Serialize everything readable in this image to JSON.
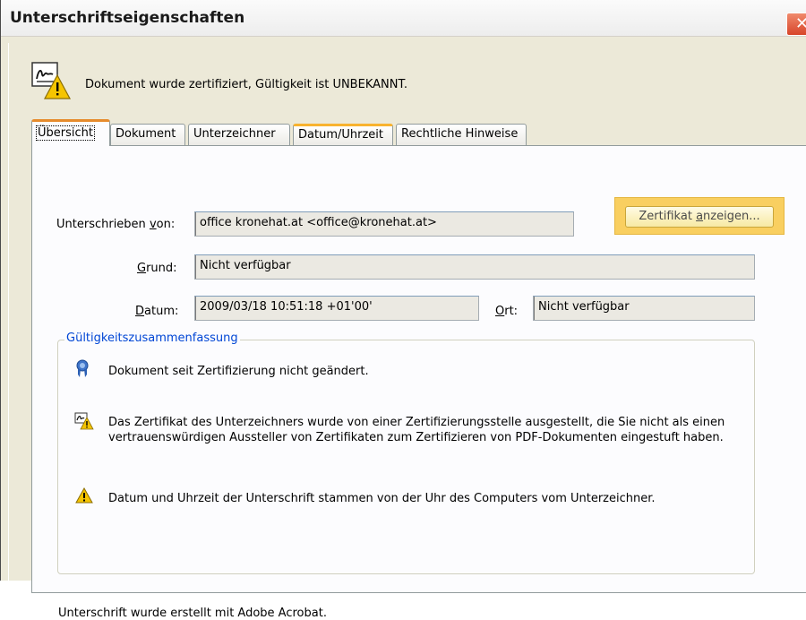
{
  "window": {
    "title": "Unterschriftseigenschaften",
    "close_label": "✕"
  },
  "header": {
    "message": "Dokument wurde zertifiziert, Gültigkeit ist UNBEKANNT."
  },
  "tabs": [
    {
      "label": "Übersicht",
      "active": true
    },
    {
      "label": "Dokument",
      "active": false
    },
    {
      "label": "Unterzeichner",
      "active": false
    },
    {
      "label": "Datum/Uhrzeit",
      "active": false
    },
    {
      "label": "Rechtliche Hinweise",
      "active": false
    }
  ],
  "summary": {
    "signed_by_label": "Unterschrieben von:",
    "signed_by_value": "office kronehat.at <office@kronehat.at>",
    "show_cert_button": "Zertifikat anzeigen...",
    "reason_label": "Grund:",
    "reason_value": "Nicht verfügbar",
    "date_label": "Datum:",
    "date_value": "2009/03/18 10:51:18 +01'00'",
    "location_label": "Ort:",
    "location_value": "Nicht verfügbar"
  },
  "validity": {
    "group_title": "Gültigkeitszusammenfassung",
    "items": [
      {
        "icon": "ribbon-icon",
        "text": "Dokument seit Zertifizierung nicht geändert."
      },
      {
        "icon": "certificate-warning-icon",
        "text": "Das Zertifikat des Unterzeichners wurde von einer Zertifizierungsstelle ausgestellt, die Sie nicht als einen vertrauenswürdigen Aussteller von Zertifikaten zum Zertifizieren von PDF-Dokumenten eingestuft haben."
      },
      {
        "icon": "warning-icon",
        "text": "Datum und Uhrzeit der Unterschrift stammen von der Uhr des Computers vom Unterzeichner."
      }
    ]
  },
  "footer": {
    "message": "Unterschrift wurde erstellt mit Adobe Acrobat."
  },
  "colors": {
    "accent_tab": "#e68b2c",
    "group_title": "#0046d5",
    "highlight": "#f9cf60"
  }
}
